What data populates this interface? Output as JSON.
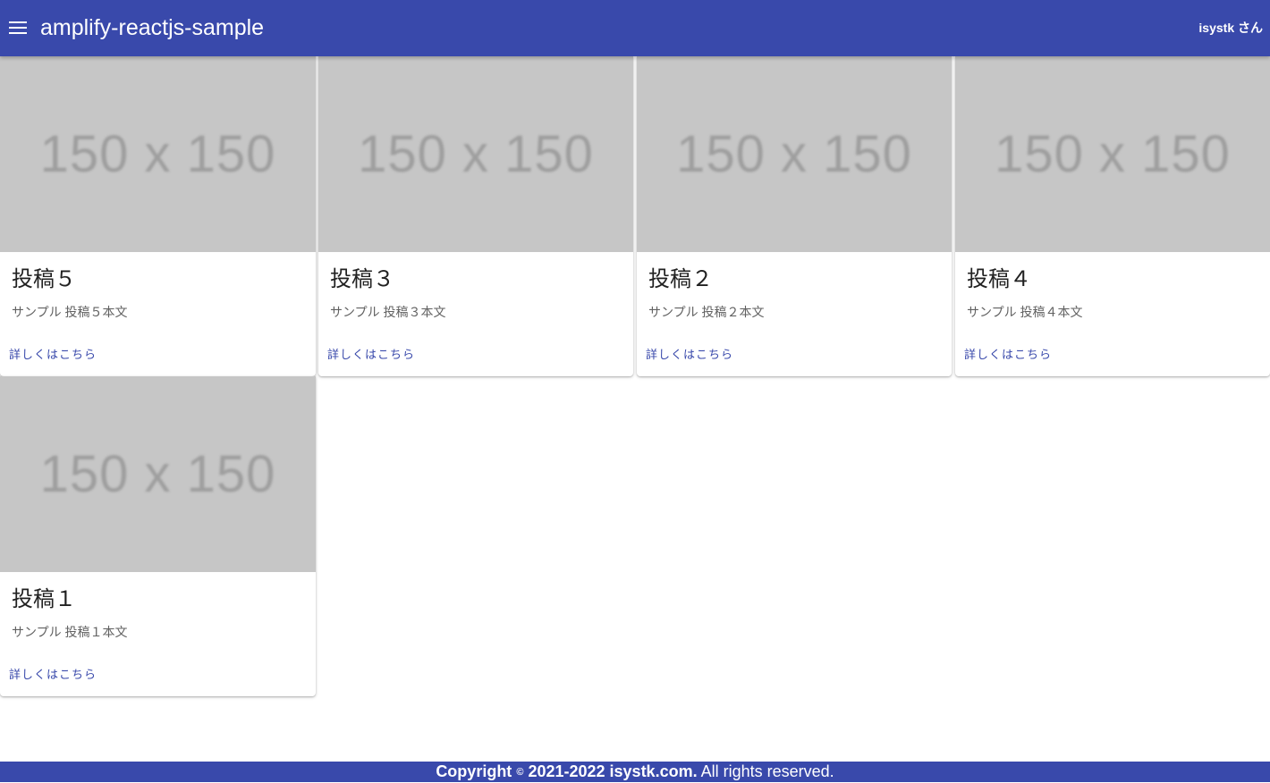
{
  "appbar": {
    "title": "amplify-reactjs-sample",
    "user": "isystk さん"
  },
  "posts": [
    {
      "image_text": "150 x 150",
      "title": "投稿５",
      "body": "サンプル 投稿５本文",
      "link": "詳しくはこちら"
    },
    {
      "image_text": "150 x 150",
      "title": "投稿３",
      "body": "サンプル 投稿３本文",
      "link": "詳しくはこちら"
    },
    {
      "image_text": "150 x 150",
      "title": "投稿２",
      "body": "サンプル 投稿２本文",
      "link": "詳しくはこちら"
    },
    {
      "image_text": "150 x 150",
      "title": "投稿４",
      "body": "サンプル 投稿４本文",
      "link": "詳しくはこちら"
    },
    {
      "image_text": "150 x 150",
      "title": "投稿１",
      "body": "サンプル 投稿１本文",
      "link": "詳しくはこちら"
    }
  ],
  "footer": {
    "copyright_word": "Copyright",
    "copyright_symbol": "©",
    "years_site": "2021-2022 isystk.com.",
    "rights": "All rights reserved."
  },
  "colors": {
    "primary": "#3949ab",
    "placeholder": "#c6c6c6"
  }
}
